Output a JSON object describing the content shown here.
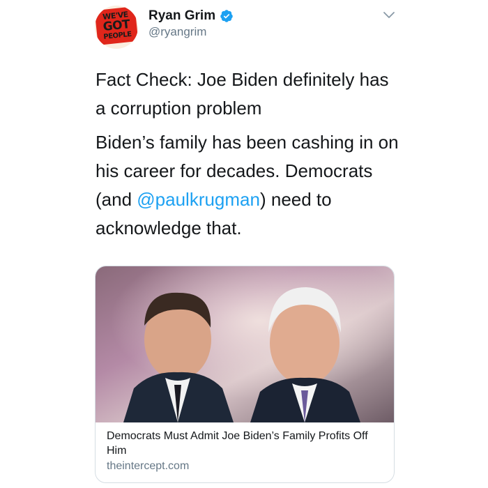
{
  "author": {
    "display_name": "Ryan Grim",
    "handle": "@ryangrim",
    "verified": true,
    "avatar_text": [
      "WE'VE",
      "GOT",
      "PEOPLE"
    ],
    "icons": {
      "verified": "verified-badge-icon",
      "menu": "chevron-down-icon"
    }
  },
  "tweet": {
    "headline": "Fact Check: Joe Biden definitely has a corruption problem",
    "body_before_mention": "Biden’s family has been cashing in on his career for decades. Democrats (and ",
    "mention": "@paulkrugman",
    "body_after_mention": ") need to acknowledge that."
  },
  "card": {
    "title": "Democrats Must Admit Joe Biden’s Family Profits Off Him",
    "domain": "theintercept.com"
  },
  "colors": {
    "link": "#1da1f2",
    "verified": "#1da1f2",
    "secondary_text": "#657786",
    "primary_text": "#14171a",
    "card_border": "#d5dde3",
    "avatar_badge": "#e0261b"
  }
}
